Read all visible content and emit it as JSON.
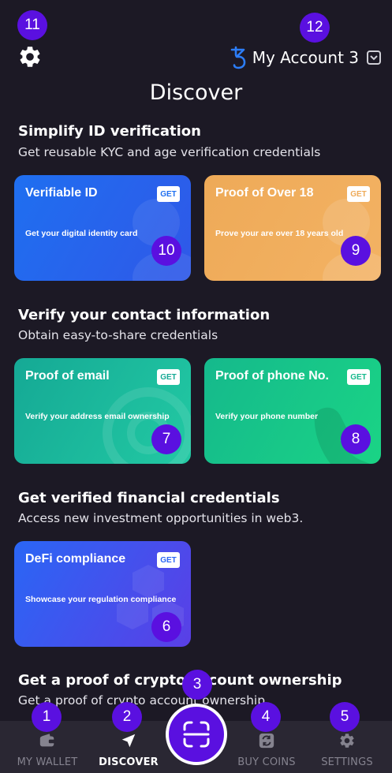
{
  "header": {
    "account_name": "My Account 3",
    "page_title": "Discover"
  },
  "sections": [
    {
      "title": "Simplify ID verification",
      "subtitle": "Get reusable KYC and age verification credentials"
    },
    {
      "title": "Verify your contact information",
      "subtitle": "Obtain easy-to-share credentials"
    },
    {
      "title": "Get verified financial credentials",
      "subtitle": "Access new investment opportunities in web3."
    },
    {
      "title": "Get a proof of crypto account ownership",
      "subtitle": "Get a proof of crypto account ownership"
    }
  ],
  "cards": [
    {
      "title": "Verifiable ID",
      "description": "Get your digital identity card",
      "action": "GET"
    },
    {
      "title": "Proof of Over 18",
      "description": "Prove your are over 18 years old",
      "action": "GET"
    },
    {
      "title": "Proof of email",
      "description": "Verify your address email ownership",
      "action": "GET"
    },
    {
      "title": "Proof of phone No.",
      "description": "Verify your phone number",
      "action": "GET"
    },
    {
      "title": "DeFi compliance",
      "description": "Showcase your regulation compliance",
      "action": "GET"
    }
  ],
  "nav": {
    "items": [
      {
        "label": "MY WALLET",
        "icon": "wallet-icon"
      },
      {
        "label": "DISCOVER",
        "icon": "send-icon"
      },
      {
        "label": "BUY COINS",
        "icon": "exchange-icon"
      },
      {
        "label": "SETTINGS",
        "icon": "gear-icon"
      }
    ],
    "active": "DISCOVER",
    "center_icon": "scan-icon"
  },
  "badges": [
    "1",
    "2",
    "3",
    "4",
    "5",
    "6",
    "7",
    "8",
    "9",
    "10",
    "11",
    "12"
  ],
  "colors": {
    "background": "#1c1925",
    "nav_background": "#2a2733",
    "accent": "#5a10e0",
    "tezos_blue": "#2c7df7",
    "card_blue": "#2563eb",
    "card_orange": "#f0a955",
    "card_teal": "#1bb89a",
    "card_green": "#16c97f",
    "card_indigo": "#3b4ef0"
  }
}
